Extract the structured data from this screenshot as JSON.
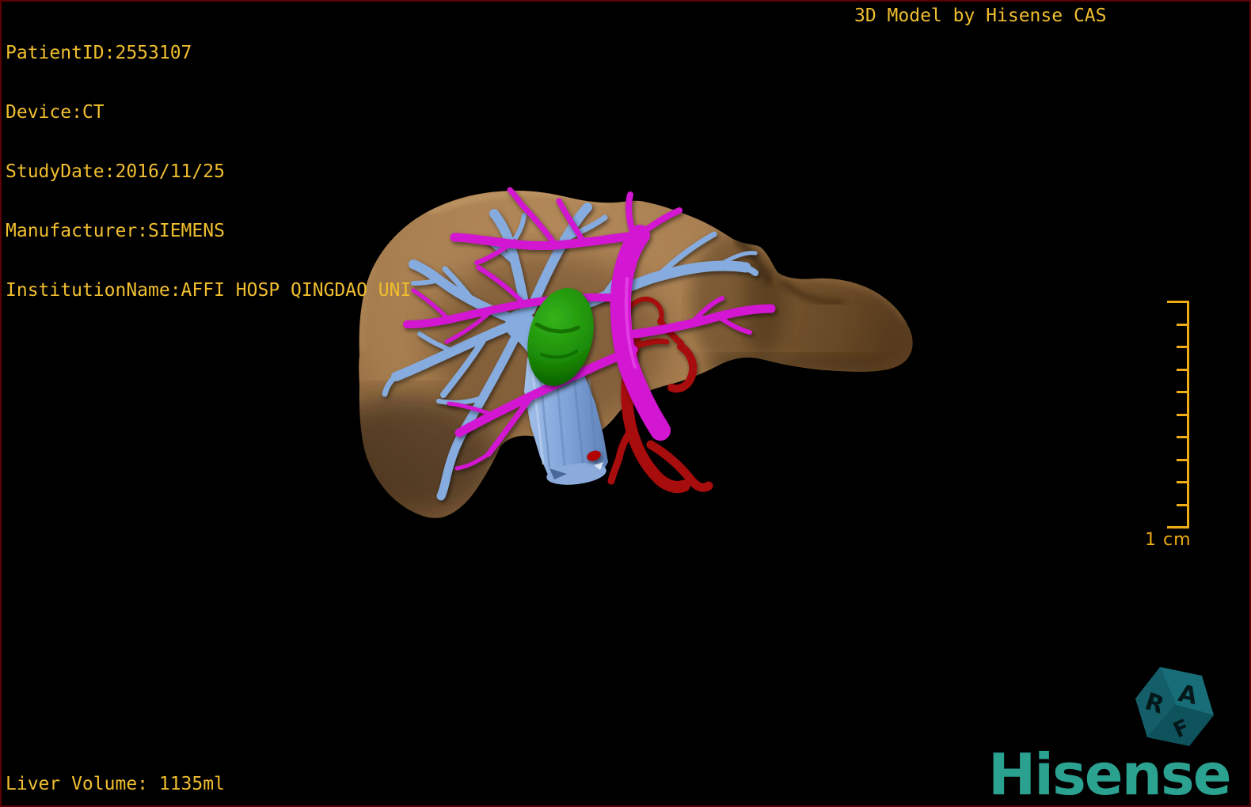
{
  "overlay": {
    "patient_lines": [
      "PatientID:2553107",
      "Device:CT",
      "StudyDate:2016/11/25",
      "Manufacturer:SIEMENS",
      "InstitutionName:AFFI HOSP QINGDAO UNI"
    ],
    "title": "3D Model by Hisense CAS",
    "liver_volume": "Liver Volume: 1135ml"
  },
  "scale_bar": {
    "label": "1 cm",
    "segments": 10
  },
  "orientation_cube": {
    "letters": [
      "R",
      "A",
      "F"
    ]
  },
  "brand": {
    "wordmark": "Hisense"
  },
  "model": {
    "description": "3D liver model with vascular trees and tumor",
    "structures": [
      {
        "name": "liver",
        "color": "#a88052"
      },
      {
        "name": "portal-vein",
        "color": "#86abdf"
      },
      {
        "name": "hepatic-vein",
        "color": "#d214d2"
      },
      {
        "name": "hepatic-artery",
        "color": "#a80808"
      },
      {
        "name": "tumor",
        "color": "#1c9007"
      }
    ]
  },
  "colors": {
    "background": "#000000",
    "border": "#5c0202",
    "text_gold": "#f0be2f",
    "scale_gold": "#f0ac14",
    "brand_teal": "#2ba190",
    "cube_teal": "#15646f"
  }
}
